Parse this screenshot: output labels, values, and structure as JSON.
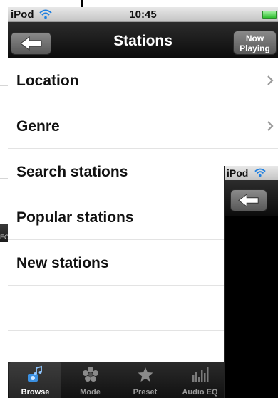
{
  "status_bar": {
    "carrier": "iPod",
    "time": "10:45"
  },
  "nav": {
    "title": "Stations",
    "now_playing_line1": "Now",
    "now_playing_line2": "Playing"
  },
  "list_items": [
    {
      "label": "Location",
      "has_chevron": true
    },
    {
      "label": "Genre",
      "has_chevron": true
    },
    {
      "label": "Search stations",
      "has_chevron": false
    },
    {
      "label": "Popular stations",
      "has_chevron": false
    },
    {
      "label": "New stations",
      "has_chevron": false
    },
    {
      "label": "",
      "has_chevron": false
    },
    {
      "label": "",
      "has_chevron": false
    }
  ],
  "tabs": [
    {
      "label": "Browse",
      "icon": "radio-music-icon",
      "active": true
    },
    {
      "label": "Mode",
      "icon": "mode-flower-icon",
      "active": false
    },
    {
      "label": "Preset",
      "icon": "star-icon",
      "active": false
    },
    {
      "label": "Audio EQ",
      "icon": "equalizer-icon",
      "active": false
    }
  ],
  "second_screen": {
    "carrier": "iPod"
  },
  "background_fragment_text": "EC",
  "colors": {
    "nav_dark": "#1a1a1a",
    "accent_blue": "#3a8fe0",
    "battery_green": "#2fbf2f"
  }
}
